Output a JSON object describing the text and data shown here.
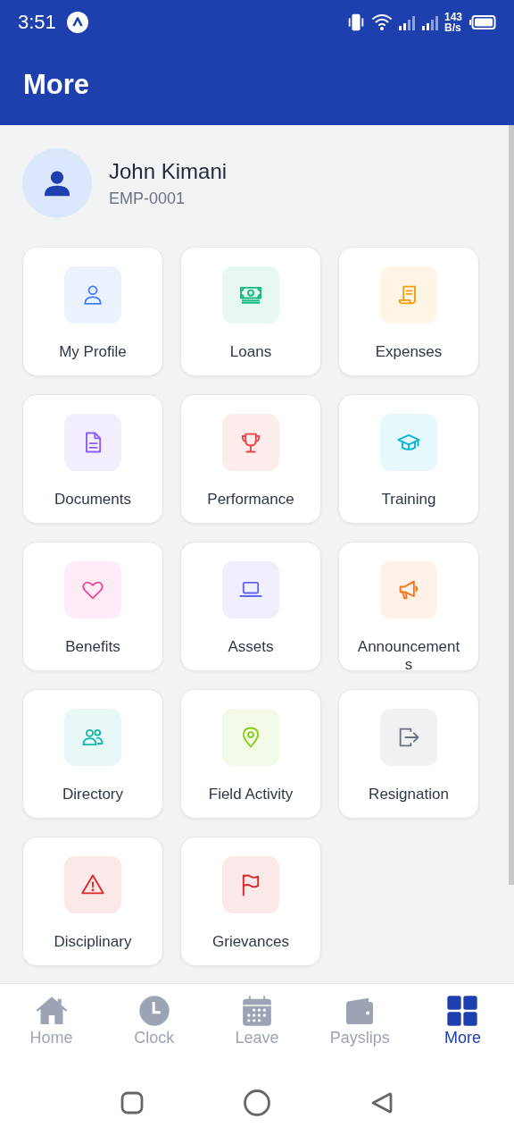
{
  "status_bar": {
    "time": "3:51",
    "speed_value": "143",
    "speed_unit": "B/s"
  },
  "header": {
    "title": "More"
  },
  "profile": {
    "name": "John Kimani",
    "employee_id": "EMP-0001"
  },
  "tiles": [
    {
      "label": "My Profile",
      "kind": "user",
      "color": "#3b82f6"
    },
    {
      "label": "Loans",
      "kind": "money",
      "color": "#10b981"
    },
    {
      "label": "Expenses",
      "kind": "receipt",
      "color": "#f59e0b"
    },
    {
      "label": "Documents",
      "kind": "document",
      "color": "#8b5cf6"
    },
    {
      "label": "Performance",
      "kind": "trophy",
      "color": "#ef4444"
    },
    {
      "label": "Training",
      "kind": "graduation",
      "color": "#06b6d4"
    },
    {
      "label": "Benefits",
      "kind": "heart",
      "color": "#ec4899"
    },
    {
      "label": "Assets",
      "kind": "laptop",
      "color": "#6366f1"
    },
    {
      "label": "Announcements",
      "kind": "megaphone",
      "color": "#f97316"
    },
    {
      "label": "Directory",
      "kind": "users",
      "color": "#14b8a6"
    },
    {
      "label": "Field Activity",
      "kind": "pin",
      "color": "#84cc16"
    },
    {
      "label": "Resignation",
      "kind": "exit",
      "color": "#6b7280"
    },
    {
      "label": "Disciplinary",
      "kind": "warning",
      "color": "#dc2626"
    },
    {
      "label": "Grievances",
      "kind": "flag",
      "color": "#dc2626"
    }
  ],
  "bottom_nav": [
    {
      "label": "Home",
      "kind": "home",
      "selected": false
    },
    {
      "label": "Clock",
      "kind": "clock",
      "selected": false
    },
    {
      "label": "Leave",
      "kind": "calendar",
      "selected": false
    },
    {
      "label": "Payslips",
      "kind": "wallet",
      "selected": false
    },
    {
      "label": "More",
      "kind": "grid",
      "selected": true
    }
  ]
}
